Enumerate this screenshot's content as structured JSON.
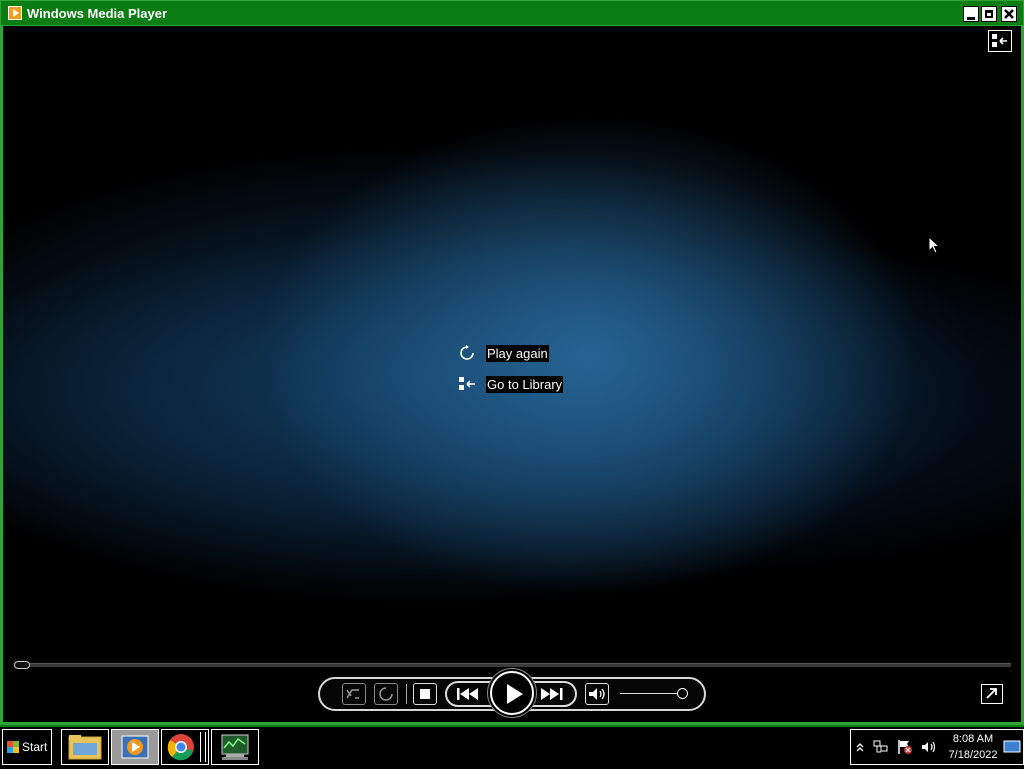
{
  "window": {
    "title": "Windows Media Player"
  },
  "center_menu": {
    "play_again": "Play again",
    "go_to_library": "Go to Library"
  },
  "playback": {
    "progress": 0,
    "volume": 1.0
  },
  "taskbar": {
    "start_label": "Start",
    "apps": [
      "File Explorer",
      "Windows Media Player",
      "Google Chrome",
      "Task Manager"
    ],
    "active_app": "Windows Media Player"
  },
  "tray": {
    "time": "8:08 AM",
    "date": "7/18/2022"
  },
  "colors": {
    "titlebar": "#0a7d12",
    "accent_border": "#2ea336",
    "video_glow": "#28699b"
  }
}
